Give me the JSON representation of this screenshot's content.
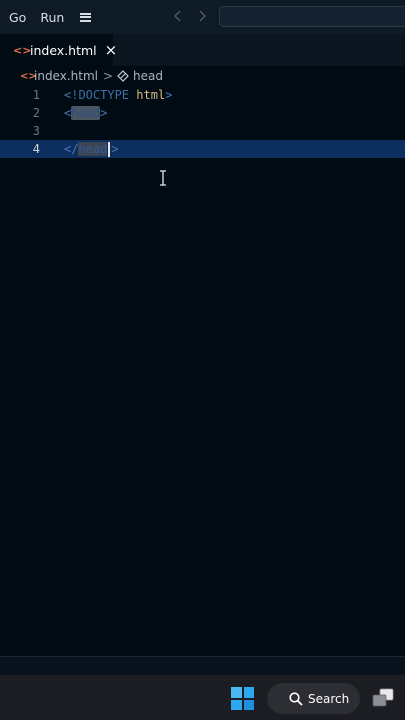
{
  "menu": {
    "go": "Go",
    "run": "Run"
  },
  "tab": {
    "filename": "index.html",
    "close": "×",
    "icon": "<>"
  },
  "breadcrumb": {
    "file": "index.html",
    "separator": ">",
    "symbol": "head"
  },
  "editor": {
    "lines": [
      {
        "number": "1",
        "open": "<",
        "doctype": "!DOCTYPE",
        "name": "html",
        "close": ">"
      },
      {
        "number": "2",
        "open": "<",
        "tag": "head",
        "close": ">"
      },
      {
        "number": "3"
      },
      {
        "number": "4",
        "open": "</",
        "tag": "head",
        "close": ">"
      }
    ],
    "active_line": 4
  },
  "taskbar": {
    "search_label": "Search"
  },
  "colors": {
    "background": "#010b14",
    "active_line": "#0d2f5f",
    "tag_name": "#d7ba7d",
    "accent_icon": "#e8734a"
  }
}
